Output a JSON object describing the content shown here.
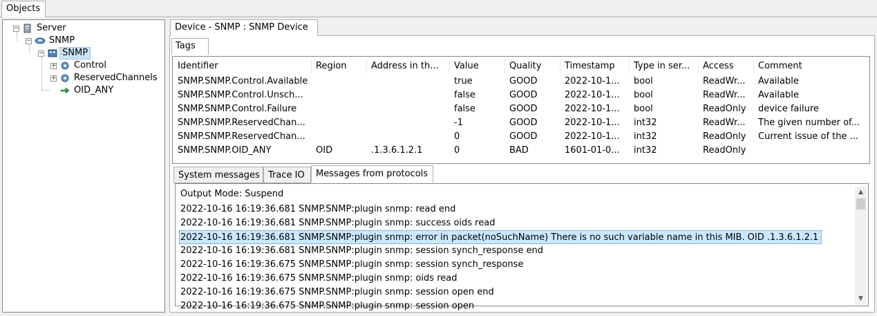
{
  "objects_tab": {
    "label": "Objects"
  },
  "tree": {
    "nodes": [
      {
        "label": "Server",
        "icon": "server-icon"
      },
      {
        "label": "SNMP",
        "icon": "network-icon"
      },
      {
        "label": "SNMP",
        "icon": "device-icon"
      },
      {
        "label": "Control",
        "icon": "gear-icon"
      },
      {
        "label": "ReservedChannels",
        "icon": "gear-icon"
      },
      {
        "label": "OID_ANY",
        "icon": "arrow-right-icon"
      }
    ],
    "expander_minus": "−",
    "expander_plus": "+"
  },
  "device_tab": {
    "label": "Device - SNMP : SNMP Device"
  },
  "tags_tab": {
    "label": "Tags"
  },
  "tags_table": {
    "columns": [
      "Identifier",
      "Region",
      "Address in th...",
      "Value",
      "Quality",
      "Timestamp",
      "Type in ser...",
      "Access",
      "Comment"
    ],
    "rows": [
      [
        "SNMP.SNMP.Control.Available",
        "",
        "",
        "true",
        "GOOD",
        "2022-10-1...",
        "bool",
        "ReadWr...",
        "Available"
      ],
      [
        "SNMP.SNMP.Control.Unsch...",
        "",
        "",
        "false",
        "GOOD",
        "2022-10-1...",
        "bool",
        "ReadWr...",
        "Available"
      ],
      [
        "SNMP.SNMP.Control.Failure",
        "",
        "",
        "false",
        "GOOD",
        "2022-10-1...",
        "bool",
        "ReadOnly",
        "device failure"
      ],
      [
        "SNMP.SNMP.ReservedChan...",
        "",
        "",
        "-1",
        "GOOD",
        "2022-10-1...",
        "int32",
        "ReadWr...",
        "The given number of..."
      ],
      [
        "SNMP.SNMP.ReservedChan...",
        "",
        "",
        "0",
        "GOOD",
        "2022-10-1...",
        "int32",
        "ReadOnly",
        "Current issue of the ..."
      ],
      [
        "SNMP.SNMP.OID_ANY",
        "OID",
        ".1.3.6.1.2.1",
        "0",
        "BAD",
        "1601-01-0...",
        "int32",
        "ReadOnly",
        ""
      ]
    ]
  },
  "bottom_tabs": [
    "System messages",
    "Trace IO",
    "Messages from protocols"
  ],
  "log": {
    "output_mode": "Output Mode: Suspend",
    "lines": [
      "2022-10-16 16:19:36.681 SNMP.SNMP:plugin snmp: read end",
      "2022-10-16 16:19:36.681 SNMP.SNMP:plugin snmp: success oids read",
      "2022-10-16 16:19:36.681 SNMP.SNMP:plugin snmp: error in packet(noSuchName) There is no such variable name in this MIB. OID .1.3.6.1.2.1",
      "2022-10-16 16:19:36.681 SNMP.SNMP:plugin snmp: session synch_response end",
      "2022-10-16 16:19:36.675 SNMP.SNMP:plugin snmp: session synch_response",
      "2022-10-16 16:19:36.675 SNMP.SNMP:plugin snmp: oids read",
      "2022-10-16 16:19:36.675 SNMP.SNMP:plugin snmp: session open end",
      "2022-10-16 16:19:36.675 SNMP.SNMP:plugin snmp: session open"
    ]
  },
  "colors": {
    "selection": "#cce8ff",
    "tree_selection": "#cce4f7"
  }
}
